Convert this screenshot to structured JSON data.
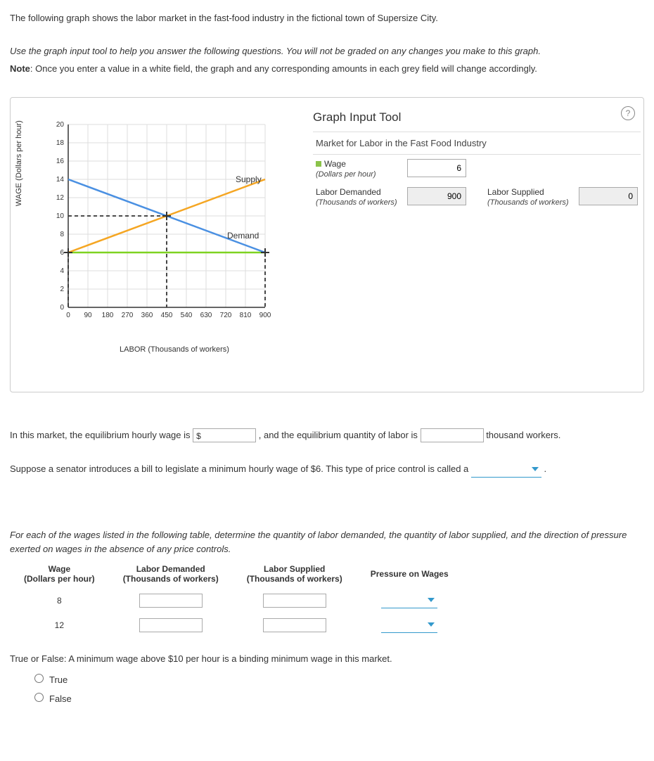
{
  "intro1": "The following graph shows the labor market in the fast-food industry in the fictional town of Supersize City.",
  "intro2": "Use the graph input tool to help you answer the following questions. You will not be graded on any changes you make to this graph.",
  "note_label": "Note",
  "note_text": ": Once you enter a value in a white field, the graph and any corresponding amounts in each grey field will change accordingly.",
  "tool": {
    "title": "Graph Input Tool",
    "section": "Market for Labor in the Fast Food Industry",
    "wage_label": "Wage",
    "wage_sub": "(Dollars per hour)",
    "wage_val": "6",
    "ld_label": "Labor Demanded",
    "ld_sub": "(Thousands of workers)",
    "ld_val": "900",
    "ls_label": "Labor Supplied",
    "ls_sub": "(Thousands of workers)",
    "ls_val": "0"
  },
  "chart_data": {
    "type": "line",
    "xlabel": "LABOR (Thousands of workers)",
    "ylabel": "WAGE (Dollars per hour)",
    "xlim": [
      0,
      900
    ],
    "ylim": [
      0,
      20
    ],
    "xticks": [
      0,
      90,
      180,
      270,
      360,
      450,
      540,
      630,
      720,
      810,
      900
    ],
    "yticks": [
      0,
      2,
      4,
      6,
      8,
      10,
      12,
      14,
      16,
      18,
      20
    ],
    "series": [
      {
        "name": "Supply",
        "color": "#f5a623",
        "points": [
          [
            0,
            6
          ],
          [
            900,
            14
          ]
        ]
      },
      {
        "name": "Demand",
        "color": "#4a90e2",
        "points": [
          [
            0,
            14
          ],
          [
            900,
            6
          ]
        ]
      }
    ],
    "horizontal_line": {
      "y": 6,
      "color": "#7ed321"
    },
    "intersection": {
      "x": 450,
      "y": 10
    },
    "dashed_guides": [
      {
        "from": [
          0,
          10
        ],
        "to": [
          450,
          10
        ]
      },
      {
        "from": [
          450,
          0
        ],
        "to": [
          450,
          10
        ]
      },
      {
        "from": [
          900,
          0
        ],
        "to": [
          900,
          6
        ]
      },
      {
        "from": [
          0,
          0
        ],
        "to": [
          0,
          6
        ]
      }
    ],
    "labels": [
      {
        "text": "Supply",
        "x": 760,
        "y": 14.2
      },
      {
        "text": "Demand",
        "x": 720,
        "y": 8
      }
    ]
  },
  "q1a": "In this market, the equilibrium hourly wage is ",
  "q1b": ", and the equilibrium quantity of labor is ",
  "q1c": " thousand workers.",
  "q2": "Suppose a senator introduces a bill to legislate a minimum hourly wage of $6. This type of price control is called a ",
  "q3": "For each of the wages listed in the following table, determine the quantity of labor demanded, the quantity of labor supplied, and the direction of pressure exerted on wages in the absence of any price controls.",
  "table": {
    "h1": "Wage",
    "h1s": "(Dollars per hour)",
    "h2": "Labor Demanded",
    "h2s": "(Thousands of workers)",
    "h3": "Labor Supplied",
    "h3s": "(Thousands of workers)",
    "h4": "Pressure on Wages",
    "rows": [
      "8",
      "12"
    ]
  },
  "q4": "True or False: A minimum wage above $10 per hour is a binding minimum wage in this market.",
  "opt_true": "True",
  "opt_false": "False"
}
